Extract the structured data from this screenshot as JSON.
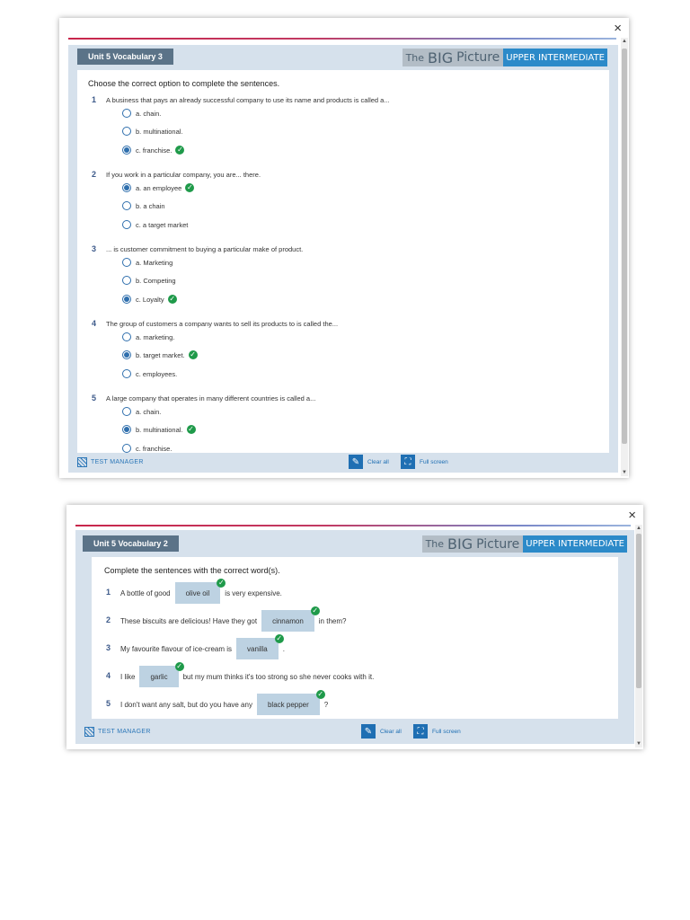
{
  "close_symbol": "×",
  "logo": {
    "the": "The",
    "big": "BIG",
    "picture": "Picture",
    "level": "UPPER INTERMEDIATE"
  },
  "icons": {
    "close": "close-icon",
    "check": "check-circle-icon",
    "clear": "eraser-icon",
    "fullscreen": "fullscreen-icon",
    "test_manager": "test-manager-icon"
  },
  "colors": {
    "tab": "#5b7388",
    "accent": "#2c8ac9",
    "correct": "#1f9a4a",
    "frame": "#d6e1ec",
    "gap": "#bdd2e2"
  },
  "footer": {
    "test_manager": "TEST MANAGER",
    "clear_all": "Clear all",
    "full_screen_1": "Full screen",
    "full_screen_2": "Full screen"
  },
  "win1": {
    "tab": "Unit 5 Vocabulary 3",
    "instructions": "Choose the correct option to complete the sentences.",
    "questions": [
      {
        "num": "1",
        "text": "A business that pays an already successful company to use its name and products is called a...",
        "options": [
          "a. chain.",
          "b. multinational.",
          "c. franchise."
        ],
        "selected": 2
      },
      {
        "num": "2",
        "text": "If you work in a particular company, you are... there.",
        "options": [
          "a. an employee",
          "b. a chain",
          "c. a target market"
        ],
        "selected": 0
      },
      {
        "num": "3",
        "text": "... is customer commitment to buying a particular make of product.",
        "options": [
          "a. Marketing",
          "b. Competing",
          "c. Loyalty"
        ],
        "selected": 2
      },
      {
        "num": "4",
        "text": "The group of customers a company wants to sell its products to is called the...",
        "options": [
          "a. marketing.",
          "b. target market.",
          "c. employees."
        ],
        "selected": 1
      },
      {
        "num": "5",
        "text": "A large company that operates in many different countries is called a...",
        "options": [
          "a. chain.",
          "b. multinational.",
          "c. franchise."
        ],
        "selected": 1
      }
    ]
  },
  "win2": {
    "tab": "Unit 5 Vocabulary 2",
    "instructions": "Complete the sentences with the correct word(s).",
    "sentences": [
      {
        "num": "1",
        "before": "A bottle of good",
        "answer": "olive oil",
        "after": "is very expensive."
      },
      {
        "num": "2",
        "before": "These biscuits are delicious! Have they got",
        "answer": "cinnamon",
        "after": "in them?"
      },
      {
        "num": "3",
        "before": "My favourite flavour of ice-cream is",
        "answer": "vanilla",
        "after": "."
      },
      {
        "num": "4",
        "before": "I like",
        "answer": "garlic",
        "after": "but my mum thinks it's too strong so she never cooks with it."
      },
      {
        "num": "5",
        "before": "I don't want any salt, but do you have any",
        "answer": "black pepper",
        "after": "?"
      }
    ]
  }
}
